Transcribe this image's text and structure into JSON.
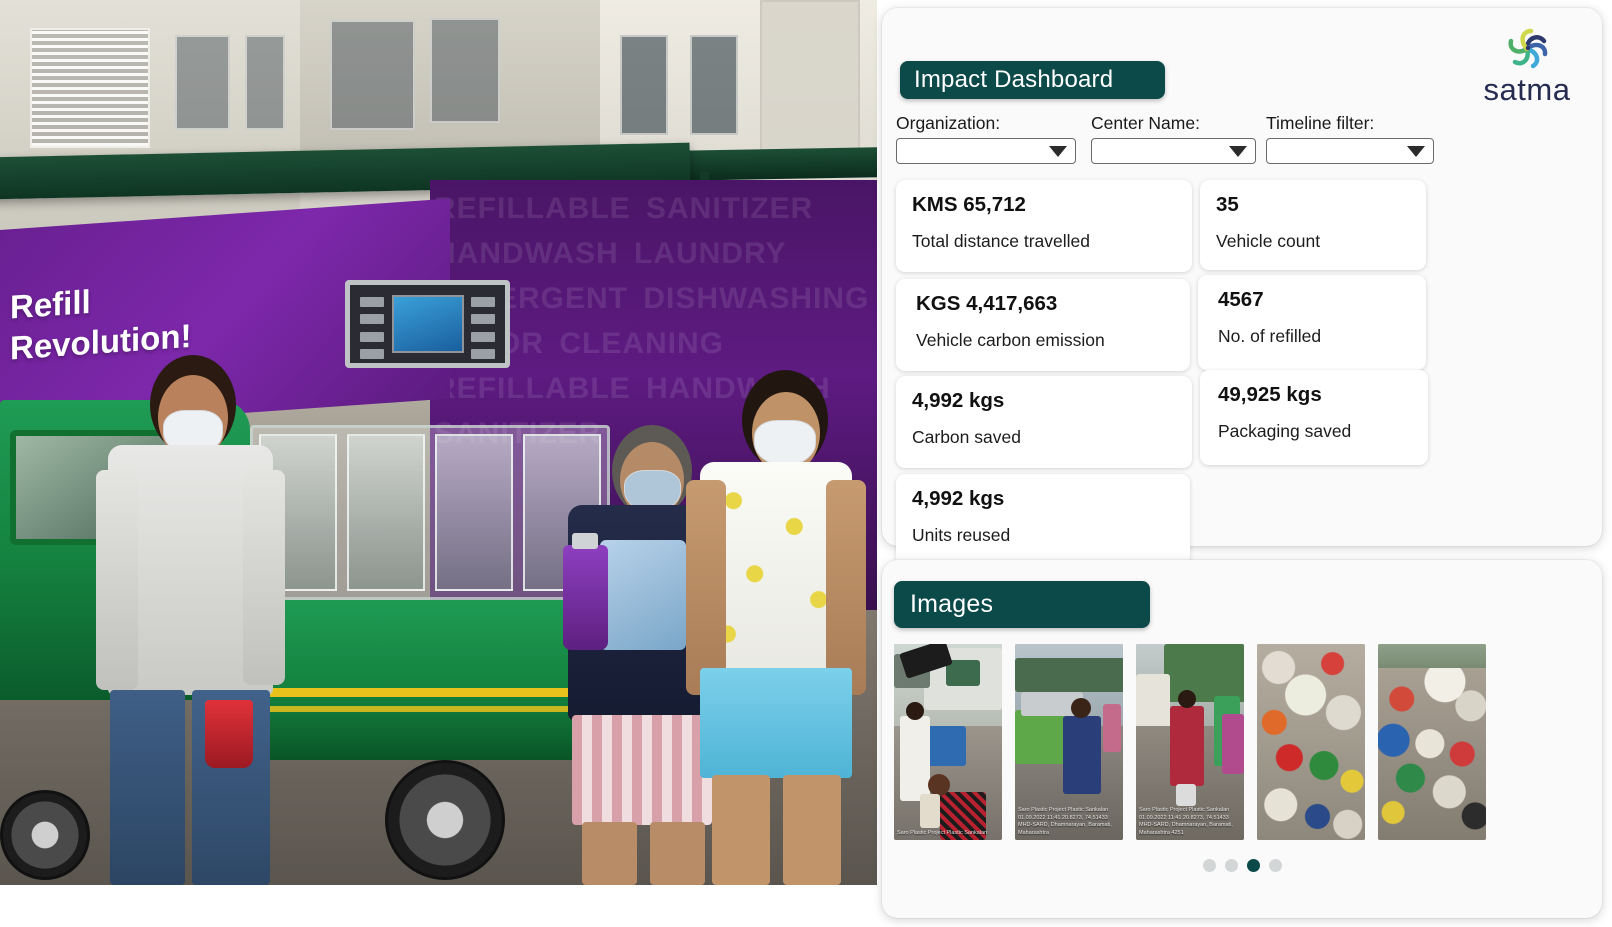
{
  "photo": {
    "alt_name": "refill-revolution-vehicle-photo",
    "vehicle_text_line1": "Refill",
    "vehicle_text_line2": "Revolution!",
    "ghost_text": "REFILLABLE SANITIZER HANDWASH LAUNDRY DETERGENT DISHWASHING FLOOR CLEANING REFILLABLE HANDWASH SANITIZER"
  },
  "dashboard": {
    "title": "Impact Dashboard",
    "logo": {
      "name": "satma",
      "mark": "spiral-icon",
      "colors": [
        "#2e3a6e",
        "#3fa9d8",
        "#4fb06a",
        "#cfd84a"
      ]
    },
    "filters": [
      {
        "label": "Organization:",
        "value": "",
        "icon": "chevron-down-icon"
      },
      {
        "label": "Center Name:",
        "value": "",
        "icon": "chevron-down-icon"
      },
      {
        "label": "Timeline filter:",
        "value": "",
        "icon": "chevron-down-icon"
      }
    ],
    "cards": [
      {
        "value": "KMS 65,712",
        "label": "Total distance travelled"
      },
      {
        "value": "35",
        "label": "Vehicle count"
      },
      {
        "value": "KGS 4,417,663",
        "label": "Vehicle carbon emission"
      },
      {
        "value": "4567",
        "label": "No. of refilled"
      },
      {
        "value": "4,992 kgs",
        "label": "Carbon saved"
      },
      {
        "value": "49,925 kgs",
        "label": "Packaging saved"
      },
      {
        "value": "4,992 kgs",
        "label": "Units reused"
      }
    ]
  },
  "images_section": {
    "title": "Images",
    "thumbnails": [
      {
        "name": "thumb-waste-collection-1",
        "stamp": "Saro Plastic Project\nPlastic Sankalan"
      },
      {
        "name": "thumb-waste-collection-2",
        "stamp": "Saro Plastic Project\nPlastic Sankalan\n01.09.2022 11:41\n20.8273, 74.51433\nMHD-SARD, Dhamnarayan, Baramati, Maharashtra"
      },
      {
        "name": "thumb-waste-collection-3",
        "stamp": "Saro Plastic Project\nPlastic Sankalan\n01.09.2022 11:41\n20.8273, 74.51433\nMHD-SARD, Dhamnarayan, Baramati, Maharashtra 4251"
      },
      {
        "name": "thumb-baled-plastic-1",
        "stamp": ""
      },
      {
        "name": "thumb-baled-plastic-2",
        "stamp": ""
      }
    ],
    "pagination": {
      "total": 4,
      "active_index": 2
    }
  },
  "theme": {
    "accent_teal": "#0c4a4a",
    "panel_bg": "#fafafa",
    "card_bg": "#ffffff",
    "logo_navy": "#262b50"
  }
}
